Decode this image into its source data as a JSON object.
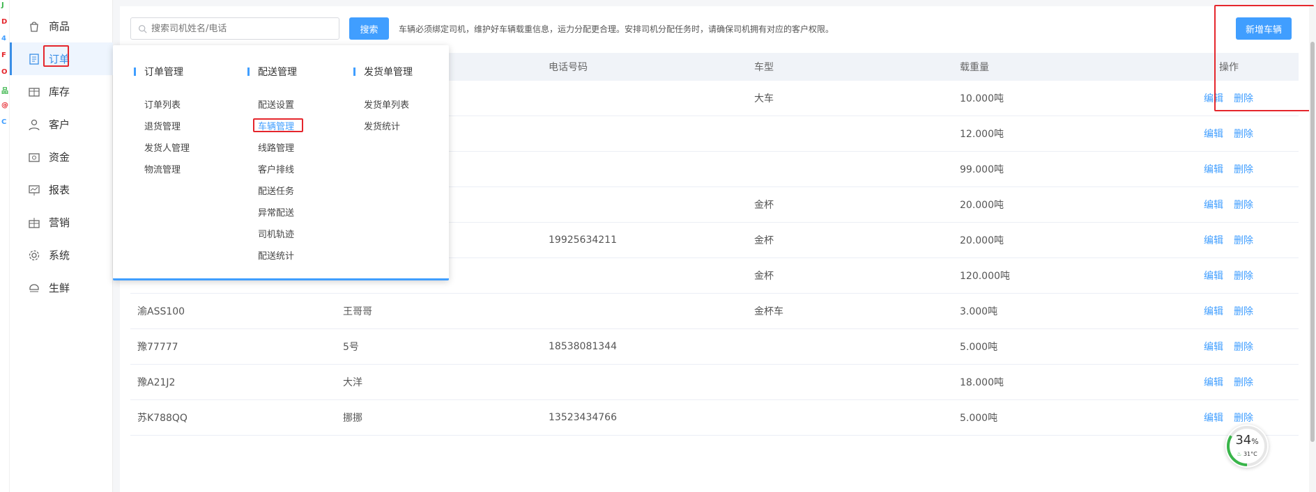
{
  "edge_chars": [
    "J",
    "D",
    "4",
    "F",
    "O",
    "品",
    "@",
    "C"
  ],
  "sidebar": {
    "items": [
      {
        "label": "商品",
        "icon": "bag-icon"
      },
      {
        "label": "订单",
        "icon": "order-list-icon"
      },
      {
        "label": "库存",
        "icon": "box-icon"
      },
      {
        "label": "客户",
        "icon": "user-icon"
      },
      {
        "label": "资金",
        "icon": "wallet-icon"
      },
      {
        "label": "报表",
        "icon": "chart-board-icon"
      },
      {
        "label": "营销",
        "icon": "gift-icon"
      },
      {
        "label": "系统",
        "icon": "gear-icon"
      },
      {
        "label": "生鲜",
        "icon": "fresh-icon"
      }
    ],
    "active": "订单"
  },
  "toolbar": {
    "search_placeholder": "搜索司机姓名/电话",
    "search_label": "搜索",
    "hint": "车辆必须绑定司机，维护好车辆载重信息，运力分配更合理。安排司机分配任务时，请确保司机拥有对应的客户权限。",
    "add_label": "新增车辆"
  },
  "dropdown": {
    "columns": [
      {
        "title": "订单管理",
        "items": [
          "订单列表",
          "退货管理",
          "发货人管理",
          "物流管理"
        ]
      },
      {
        "title": "配送管理",
        "items": [
          "配送设置",
          "车辆管理",
          "线路管理",
          "客户排线",
          "配送任务",
          "异常配送",
          "司机轨迹",
          "配送统计"
        ]
      },
      {
        "title": "发货单管理",
        "items": [
          "发货单列表",
          "发货统计"
        ]
      }
    ],
    "active_item": "车辆管理"
  },
  "table": {
    "headers": [
      "电话号码",
      "车型",
      "载重量",
      "操作"
    ],
    "rows": [
      {
        "plate": "",
        "driver": "",
        "phone": "",
        "type": "大车",
        "load": "10.000吨"
      },
      {
        "plate": "",
        "driver": "",
        "phone": "",
        "type": "",
        "load": "12.000吨"
      },
      {
        "plate": "",
        "driver": "",
        "phone": "",
        "type": "",
        "load": "99.000吨"
      },
      {
        "plate": "",
        "driver": "",
        "phone": "",
        "type": "金杯",
        "load": "20.000吨"
      },
      {
        "plate": "",
        "driver": "",
        "phone": "19925634211",
        "type": "金杯",
        "load": "20.000吨"
      },
      {
        "plate": "",
        "driver": "",
        "phone": "",
        "type": "金杯",
        "load": "120.000吨"
      },
      {
        "plate": "渝ASS100",
        "driver": "王哥哥",
        "phone": "",
        "type": "金杯车",
        "load": "3.000吨"
      },
      {
        "plate": "豫77777",
        "driver": "5号",
        "phone": "18538081344",
        "type": "",
        "load": "5.000吨"
      },
      {
        "plate": "豫A21J2",
        "driver": "大洋",
        "phone": "",
        "type": "",
        "load": "18.000吨"
      },
      {
        "plate": "苏K788QQ",
        "driver": "挪挪",
        "phone": "13523434766",
        "type": "",
        "load": "5.000吨"
      }
    ],
    "edit_label": "编辑",
    "delete_label": "删除"
  },
  "gauge": {
    "percent": "34",
    "percent_unit": "%",
    "temp": "31°C",
    "fill": 0.34
  },
  "colors": {
    "accent": "#409eff",
    "highlight": "#e5262c",
    "active_bg": "#eef5fe"
  }
}
